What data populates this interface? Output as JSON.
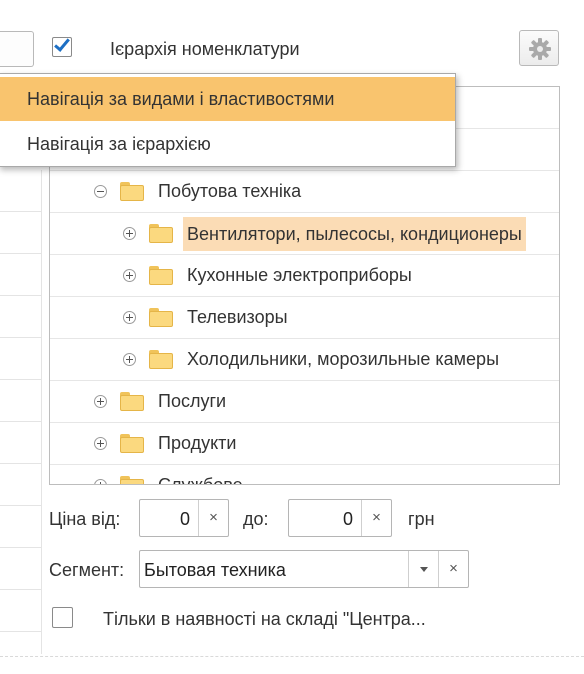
{
  "header": {
    "hierarchy_checkbox_checked": true,
    "hierarchy_label": "Ієрархія номенклатури",
    "settings_icon": "gear-icon"
  },
  "navigation_menu": {
    "items": [
      {
        "label": "Навігація за видами і властивостями",
        "active": true
      },
      {
        "label": "Навігація за ієрархією",
        "active": false
      }
    ]
  },
  "tree": {
    "rows": [
      {
        "label": "",
        "level": 0,
        "expander": "none"
      },
      {
        "label": "",
        "level": 0,
        "expander": "none"
      },
      {
        "label": "Побутова техніка",
        "level": 1,
        "expander": "minus"
      },
      {
        "label": "Вентилятори, пылесосы, кондиционеры",
        "level": 2,
        "expander": "plus",
        "selected": true
      },
      {
        "label": "Кухонные электроприборы",
        "level": 2,
        "expander": "plus"
      },
      {
        "label": "Телевизоры",
        "level": 2,
        "expander": "plus"
      },
      {
        "label": "Холодильники, морозильные камеры",
        "level": 2,
        "expander": "plus"
      },
      {
        "label": "Послуги",
        "level": 1,
        "expander": "plus"
      },
      {
        "label": "Продукти",
        "level": 1,
        "expander": "plus"
      },
      {
        "label": "Службове",
        "level": 1,
        "expander": "plus"
      }
    ]
  },
  "price_filter": {
    "from_label": "Ціна від:",
    "from_value": "0",
    "to_label": "до:",
    "to_value": "0",
    "currency": "грн",
    "clear_symbol": "×"
  },
  "segment": {
    "label": "Сегмент:",
    "value": "Бытовая техника",
    "clear_symbol": "×"
  },
  "stock_filter": {
    "checked": false,
    "label": "Тільки в наявності на складі \"Центра..."
  },
  "colors": {
    "accent_check": "#1d6fc4",
    "menu_active": "#f9c46e",
    "selected_row": "#fbdcb5",
    "folder": "#fbd97f"
  }
}
